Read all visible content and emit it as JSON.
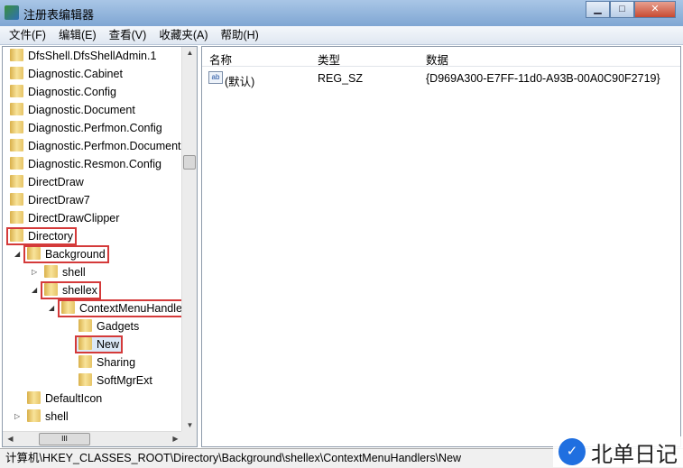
{
  "window": {
    "title": "注册表编辑器",
    "minimize": "▁",
    "maximize": "□",
    "close": "✕"
  },
  "menu": [
    "文件(F)",
    "编辑(E)",
    "查看(V)",
    "收藏夹(A)",
    "帮助(H)"
  ],
  "tree": [
    {
      "label": "DfsShell.DfsShellAdmin.1",
      "level": 0
    },
    {
      "label": "Diagnostic.Cabinet",
      "level": 0
    },
    {
      "label": "Diagnostic.Config",
      "level": 0
    },
    {
      "label": "Diagnostic.Document",
      "level": 0
    },
    {
      "label": "Diagnostic.Perfmon.Config",
      "level": 0
    },
    {
      "label": "Diagnostic.Perfmon.Document",
      "level": 0
    },
    {
      "label": "Diagnostic.Resmon.Config",
      "level": 0
    },
    {
      "label": "DirectDraw",
      "level": 0
    },
    {
      "label": "DirectDraw7",
      "level": 0
    },
    {
      "label": "DirectDrawClipper",
      "level": 0
    },
    {
      "label": "Directory",
      "level": 0,
      "highlight": true
    },
    {
      "label": "Background",
      "level": 1,
      "expander": "expanded",
      "highlight": true
    },
    {
      "label": "shell",
      "level": 2,
      "expander": "collapsed"
    },
    {
      "label": "shellex",
      "level": 2,
      "expander": "expanded",
      "highlight": true
    },
    {
      "label": "ContextMenuHandlers",
      "level": 3,
      "expander": "expanded",
      "highlight": true
    },
    {
      "label": "Gadgets",
      "level": 4
    },
    {
      "label": "New",
      "level": 4,
      "highlight": true,
      "selected": true
    },
    {
      "label": "Sharing",
      "level": 4
    },
    {
      "label": "SoftMgrExt",
      "level": 4
    },
    {
      "label": "DefaultIcon",
      "level": 1
    },
    {
      "label": "shell",
      "level": 1,
      "expander": "collapsed"
    }
  ],
  "list": {
    "headers": {
      "name": "名称",
      "type": "类型",
      "data": "数据"
    },
    "rows": [
      {
        "icon": "ab",
        "name": "(默认)",
        "type": "REG_SZ",
        "data": "{D969A300-E7FF-11d0-A93B-00A0C90F2719}"
      }
    ]
  },
  "status": "计算机\\HKEY_CLASSES_ROOT\\Directory\\Background\\shellex\\ContextMenuHandlers\\New",
  "watermark": {
    "logo": "W",
    "text": "北单日记"
  },
  "colors": {
    "highlight": "#d43a3a",
    "selection": "#dce9f7"
  }
}
